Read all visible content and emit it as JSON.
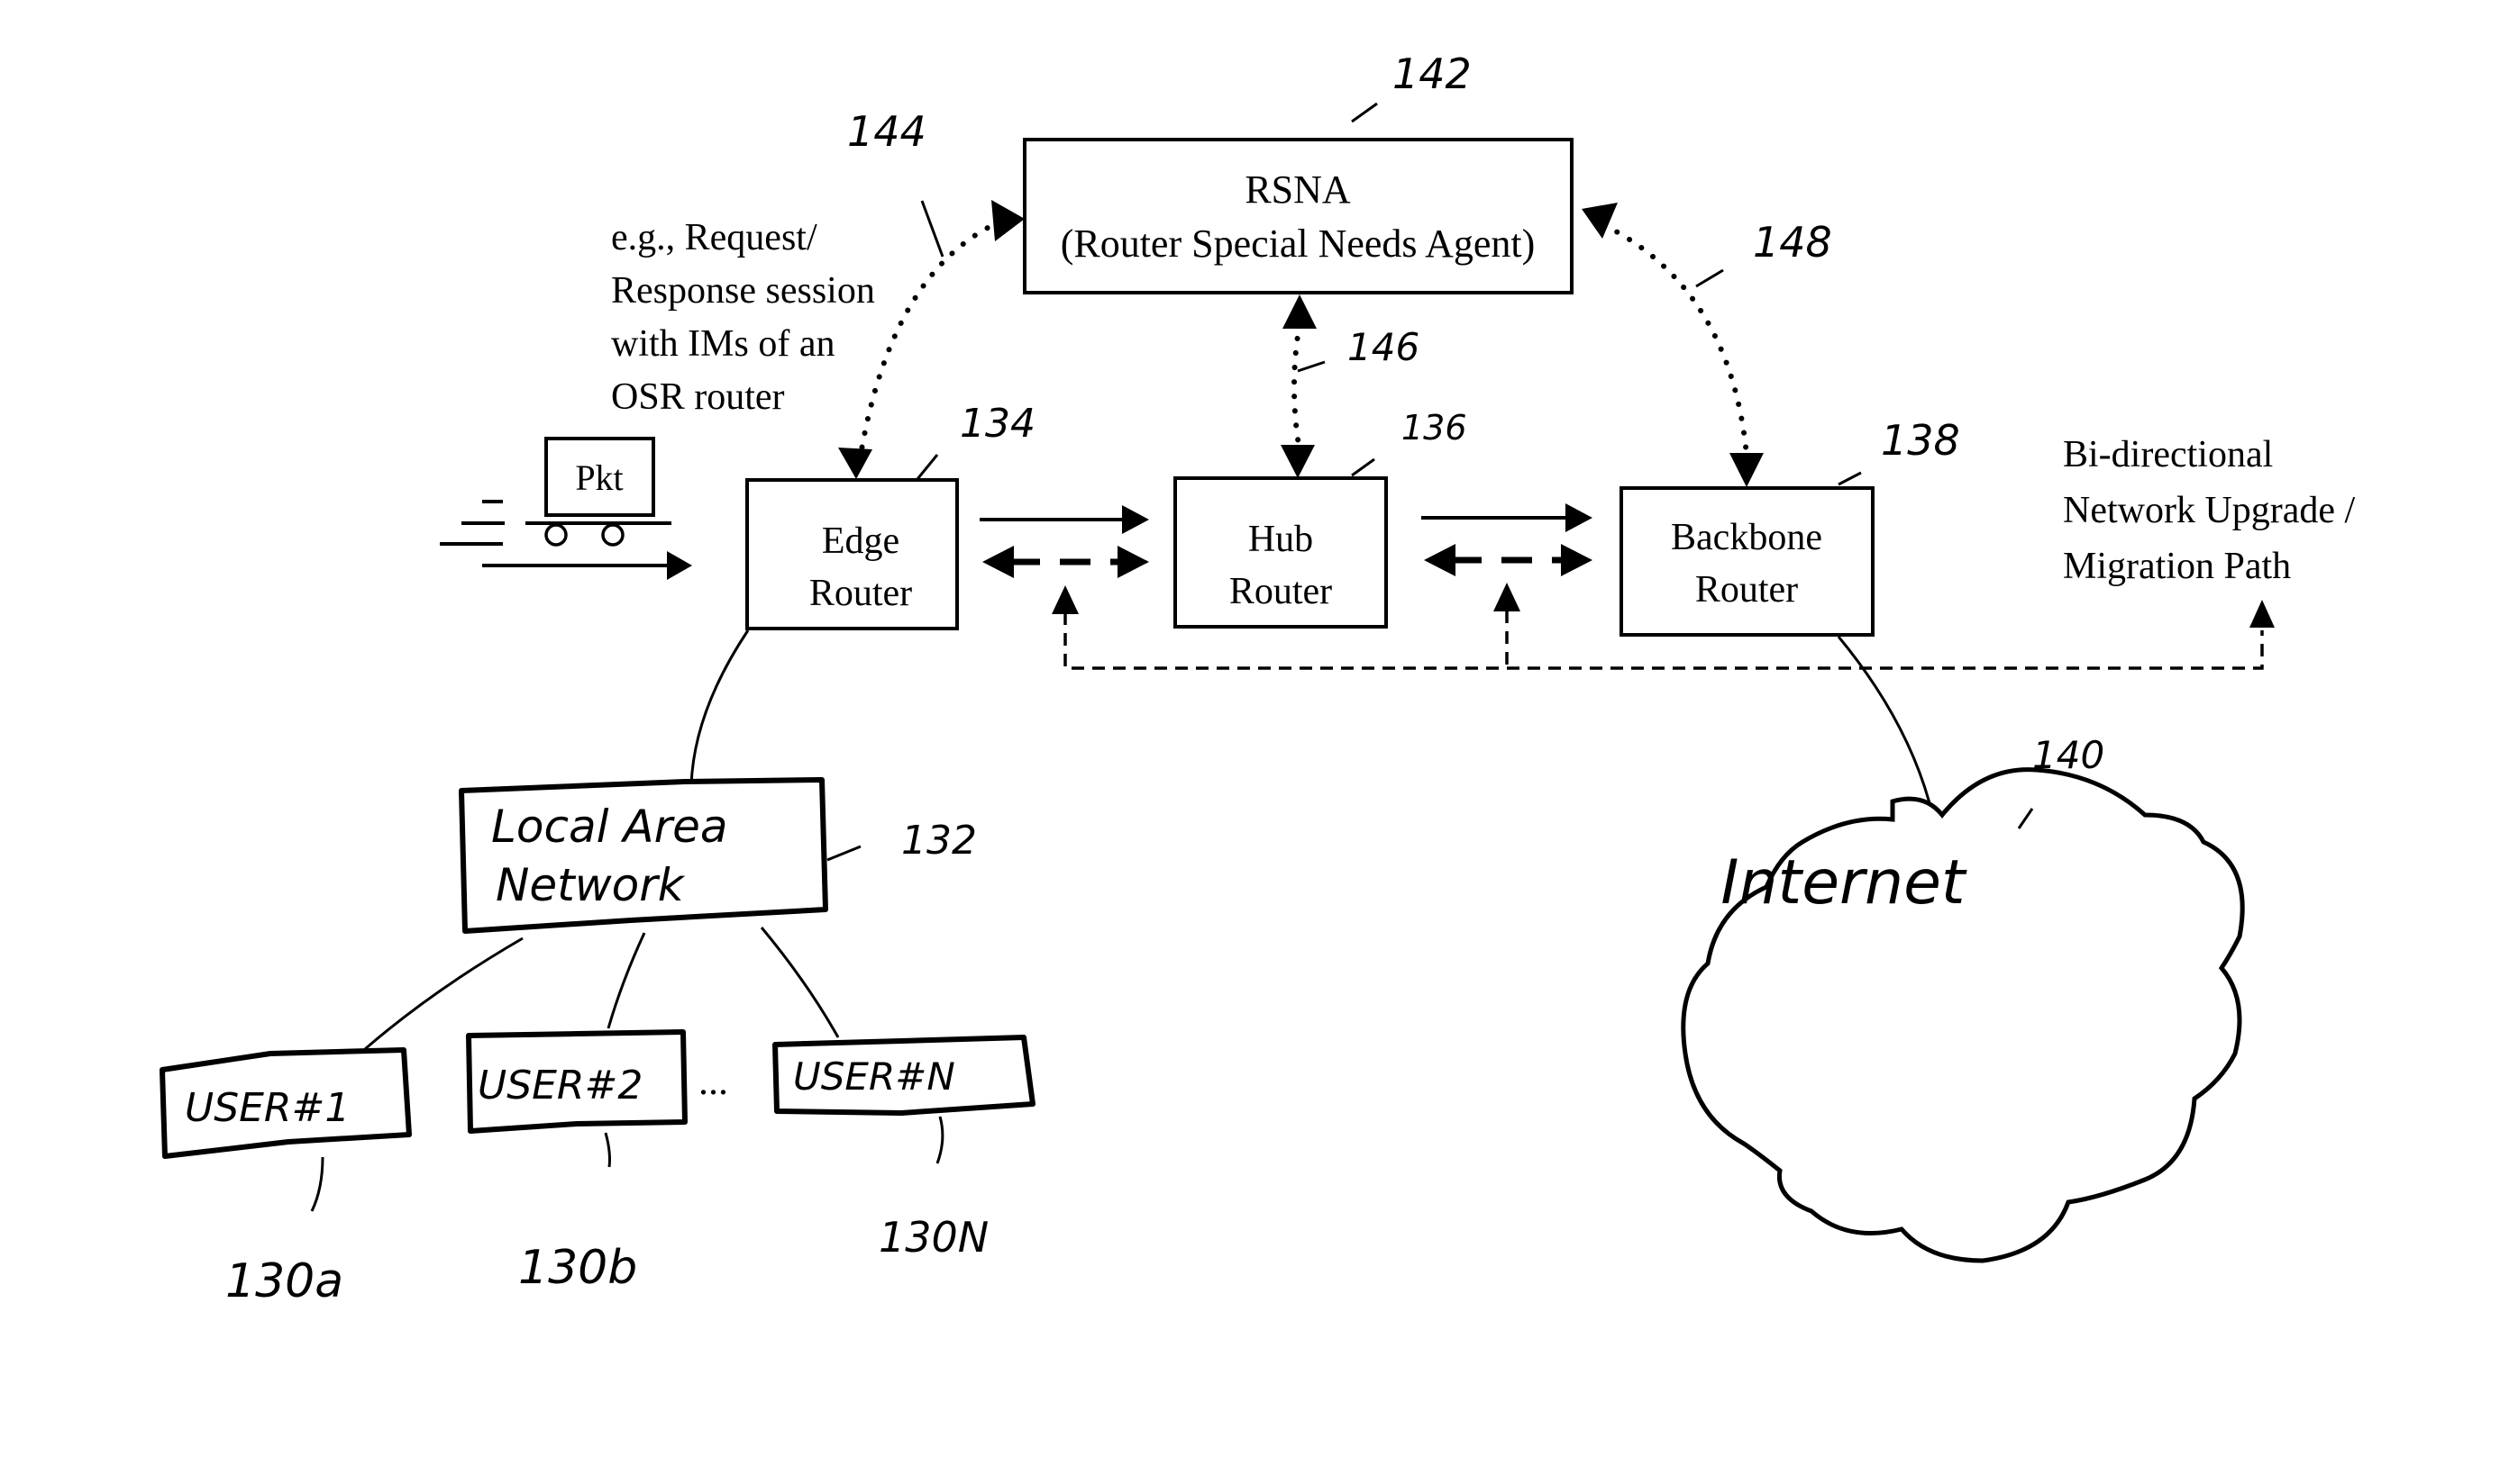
{
  "diagram": {
    "type": "network-architecture-patent-figure",
    "rsna": {
      "title": "RSNA",
      "subtitle": "(Router Special Needs Agent)",
      "ref": "142"
    },
    "session_note": {
      "lines": [
        "e.g., Request/",
        "Response session",
        "with IMs of an",
        "OSR router"
      ],
      "ref": "144"
    },
    "routers": {
      "edge": {
        "line1": "Edge",
        "line2": "Router",
        "ref": "134"
      },
      "hub": {
        "line1": "Hub",
        "line2": "Router",
        "ref": "136"
      },
      "backbone": {
        "line1": "Backbone",
        "line2": "Router",
        "ref": "138"
      }
    },
    "links": {
      "rsna_hub_ref": "146",
      "rsna_backbone_ref": "148"
    },
    "packet": {
      "label": "Pkt"
    },
    "upgrade_note": {
      "lines": [
        "Bi-directional",
        "Network Upgrade /",
        "Migration Path"
      ]
    },
    "lan": {
      "line1": "Local Area",
      "line2": "Network",
      "ref": "132"
    },
    "users": [
      {
        "label": "USER#1",
        "ref": "130a"
      },
      {
        "label": "USER#2",
        "ref": "130b"
      },
      {
        "label": "USER#N",
        "ref": "130N"
      }
    ],
    "ellipsis": "...",
    "internet": {
      "label": "Internet",
      "ref": "140"
    }
  }
}
